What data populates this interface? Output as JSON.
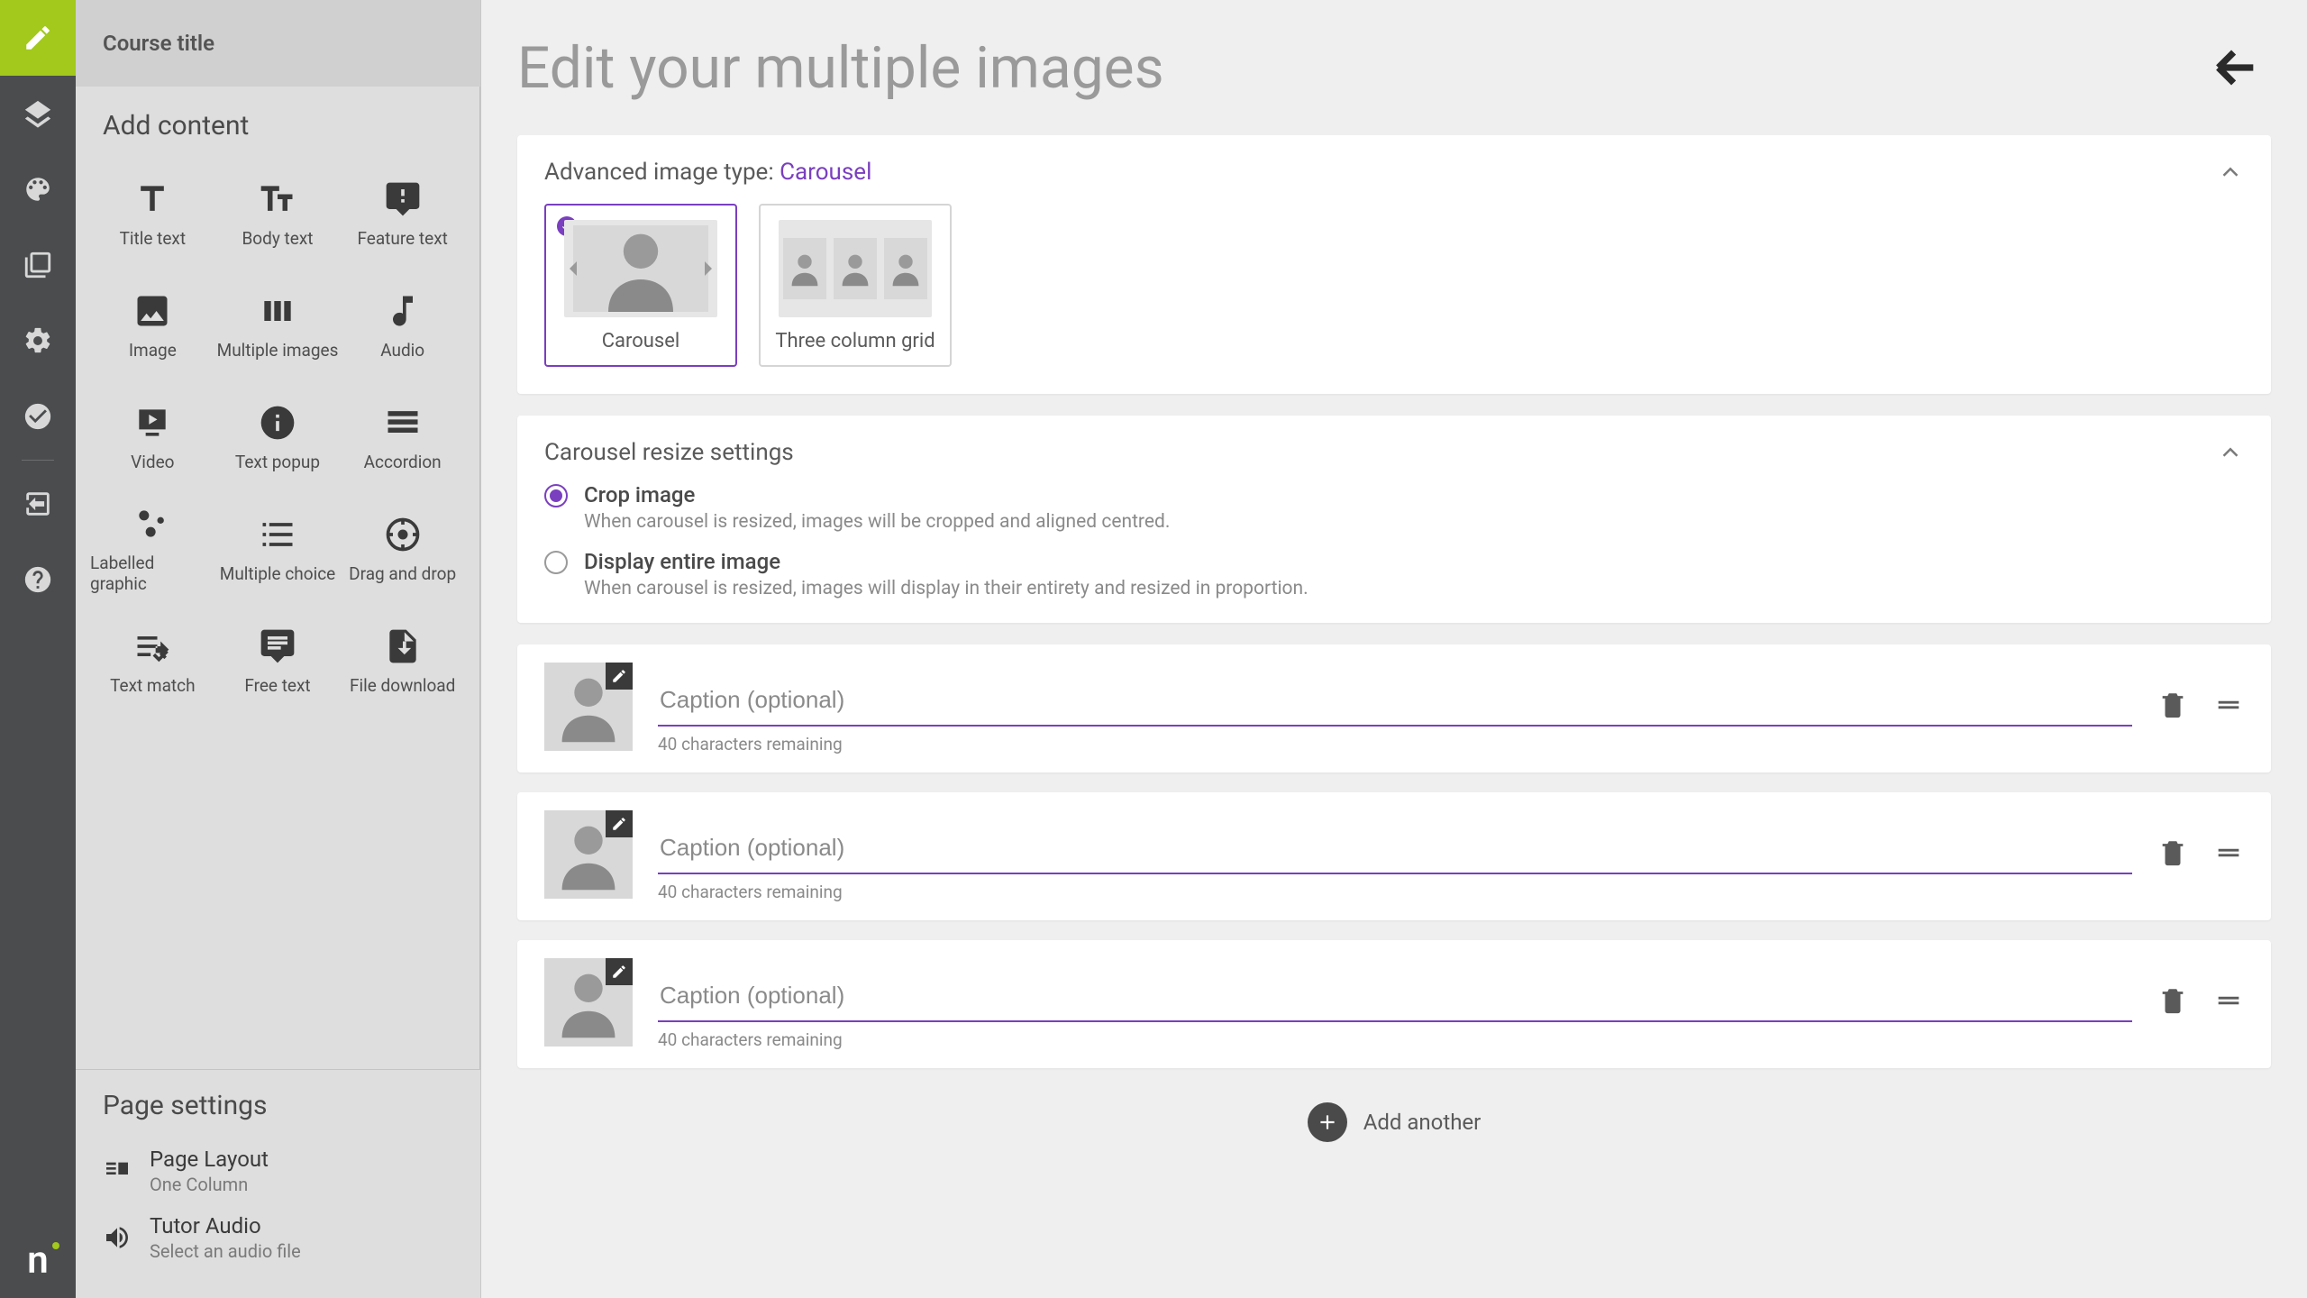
{
  "sidebar": {
    "course_title": "Course title",
    "add_content": "Add content",
    "items": [
      "Title text",
      "Body text",
      "Feature text",
      "Image",
      "Multiple images",
      "Audio",
      "Video",
      "Text popup",
      "Accordion",
      "Labelled graphic",
      "Multiple choice",
      "Drag and drop",
      "Text match",
      "Free text",
      "File download"
    ],
    "page_settings": "Page settings",
    "ps_layout_label": "Page Layout",
    "ps_layout_sub": "One Column",
    "ps_audio_label": "Tutor Audio",
    "ps_audio_sub": "Select an audio file"
  },
  "main": {
    "title": "Edit your multiple images",
    "adv_label": "Advanced image type: ",
    "adv_value": "Carousel",
    "type_carousel": "Carousel",
    "type_grid": "Three column grid",
    "resize_title": "Carousel resize settings",
    "radio1_label": "Crop image",
    "radio1_desc": "When carousel is resized, images will be cropped and aligned centred.",
    "radio2_label": "Display entire image",
    "radio2_desc": "When carousel is resized, images will display in their entirety and resized in proportion.",
    "caption_placeholder": "Caption (optional)",
    "char_remaining": "40 characters remaining",
    "add_another": "Add another"
  }
}
